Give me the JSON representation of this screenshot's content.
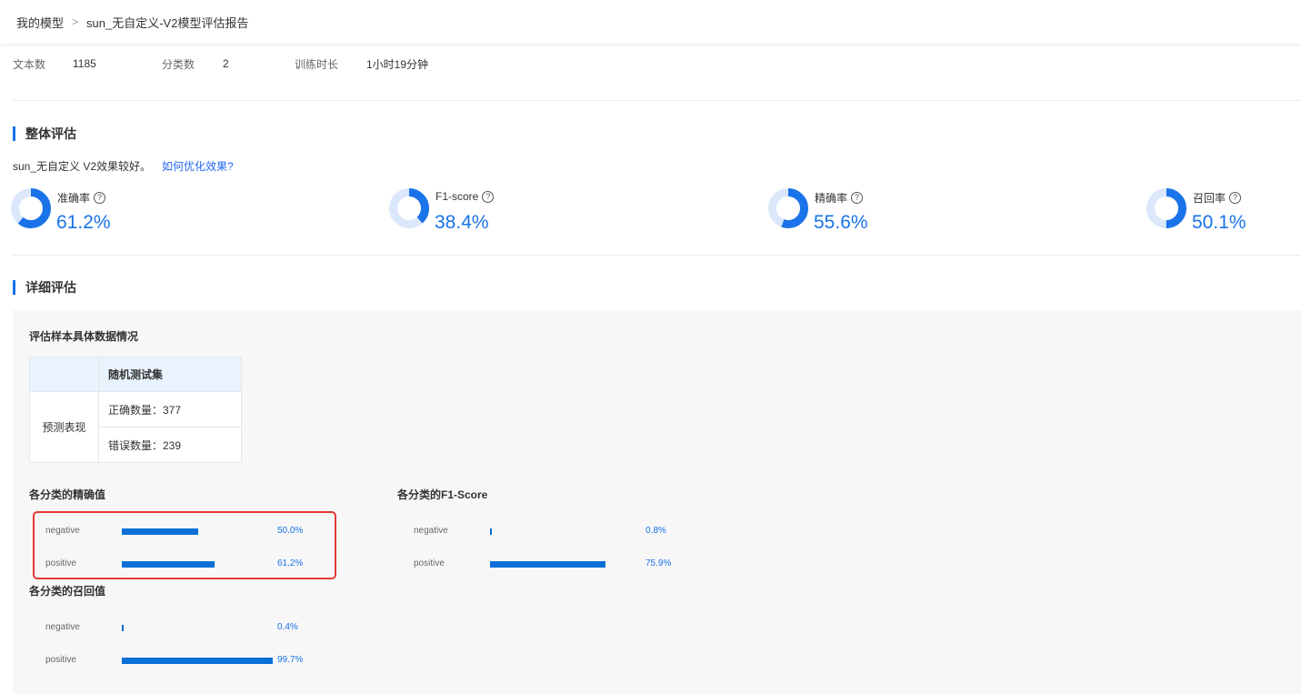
{
  "breadcrumb": {
    "root": "我的模型",
    "current": "sun_无自定义-V2模型评估报告"
  },
  "stats": [
    {
      "label": "文本数",
      "value": "1185"
    },
    {
      "label": "分类数",
      "value": "2"
    },
    {
      "label": "训练时长",
      "value": "1小时19分钟"
    }
  ],
  "overall": {
    "title": "整体评估",
    "summary": "sun_无自定义 V2效果较好。",
    "link": "如何优化效果?",
    "metrics": [
      {
        "label": "准确率",
        "value": "61.2%",
        "fraction": 0.612
      },
      {
        "label": "F1-score",
        "value": "38.4%",
        "fraction": 0.384
      },
      {
        "label": "精确率",
        "value": "55.6%",
        "fraction": 0.556
      },
      {
        "label": "召回率",
        "value": "50.1%",
        "fraction": 0.501
      }
    ],
    "help_glyph": "?",
    "colors": {
      "ring": "#1a73e8",
      "ring_bg": "#dbe7fb"
    }
  },
  "detail": {
    "title": "详细评估",
    "panel_title": "评估样本具体数据情况",
    "table": {
      "header": "随机测试集",
      "row_head": "预测表现",
      "correct": "正确数量：377",
      "wrong": "错误数量：239"
    }
  },
  "chart_data": [
    {
      "type": "bar",
      "title": "各分类的精确值",
      "categories": [
        "negative",
        "positive"
      ],
      "values": [
        50.0,
        61.2
      ],
      "labels": [
        "50.0%",
        "61.2%"
      ],
      "xlim": [
        0,
        100
      ]
    },
    {
      "type": "bar",
      "title": "各分类的F1-Score",
      "categories": [
        "negative",
        "positive"
      ],
      "values": [
        0.8,
        75.9
      ],
      "labels": [
        "0.8%",
        "75.9%"
      ],
      "xlim": [
        0,
        100
      ]
    },
    {
      "type": "bar",
      "title": "各分类的召回值",
      "categories": [
        "negative",
        "positive"
      ],
      "values": [
        0.4,
        99.7
      ],
      "labels": [
        "0.4%",
        "99.7%"
      ],
      "xlim": [
        0,
        100
      ]
    }
  ]
}
